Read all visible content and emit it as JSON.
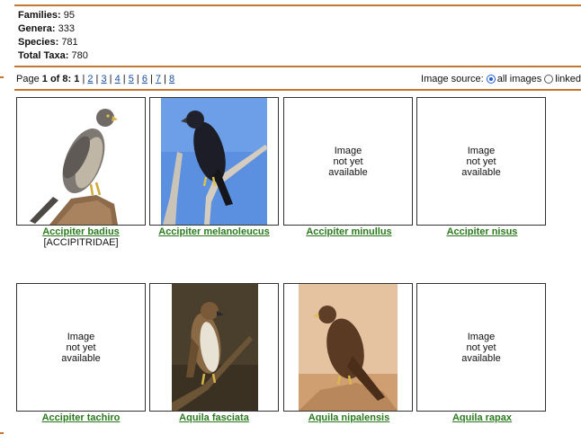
{
  "stats": {
    "families_label": "Families:",
    "families": "95",
    "genera_label": "Genera:",
    "genera": "333",
    "species_label": "Species:",
    "species": "781",
    "total_label": "Total Taxa:",
    "total": "780"
  },
  "pager": {
    "prefix": "Page",
    "current": "1",
    "of": "of",
    "total": "8",
    "pages": [
      "1",
      "2",
      "3",
      "4",
      "5",
      "6",
      "7",
      "8"
    ]
  },
  "image_source": {
    "label": "Image source:",
    "options": [
      "all images",
      "linked"
    ],
    "selected": "all images"
  },
  "no_image_text": [
    "Image",
    "not yet",
    "available"
  ],
  "items": [
    {
      "name": "Accipiter badius",
      "family": "[ACCIPITRIDAE]",
      "has_image": true,
      "icon": "perched-hawk-icon"
    },
    {
      "name": "Accipiter melanoleucus",
      "has_image": true,
      "icon": "black-hawk-icon"
    },
    {
      "name": "Accipiter minullus",
      "has_image": false
    },
    {
      "name": "Accipiter nisus",
      "has_image": false
    },
    {
      "name": "Accipiter tachiro",
      "has_image": false
    },
    {
      "name": "Aquila fasciata",
      "has_image": true,
      "icon": "eagle-on-branch-icon"
    },
    {
      "name": "Aquila nipalensis",
      "has_image": true,
      "icon": "steppe-eagle-icon"
    },
    {
      "name": "Aquila rapax",
      "has_image": false
    }
  ],
  "colors": {
    "rule": "#c7772d",
    "link_green": "#2b7a1e",
    "link_blue": "#1a4fa0"
  }
}
